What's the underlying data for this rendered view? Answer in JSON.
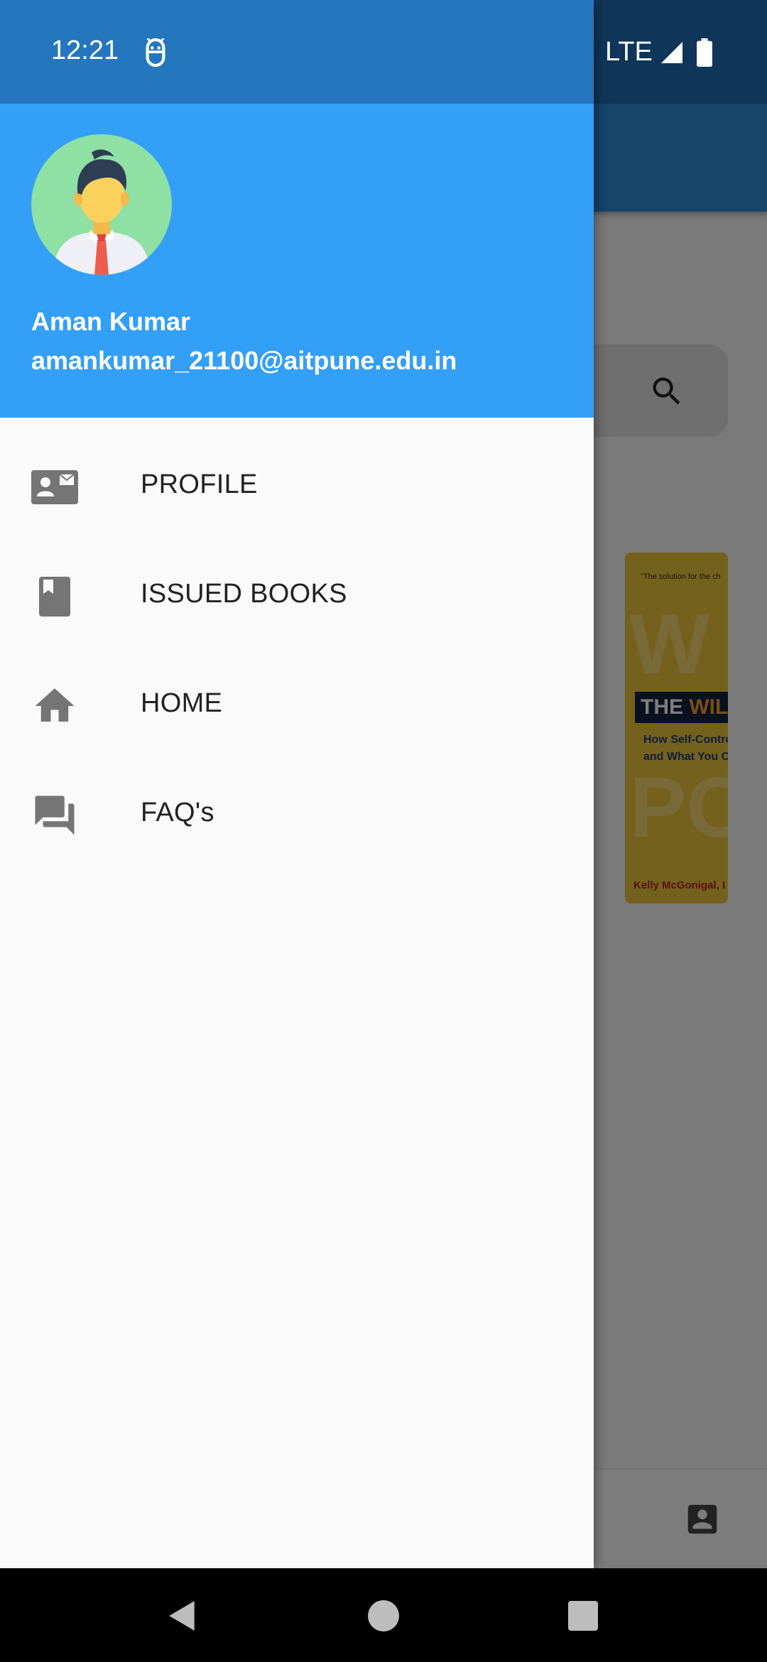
{
  "status_bar": {
    "time": "12:21",
    "network": "LTE"
  },
  "drawer": {
    "user": {
      "name": "Aman Kumar",
      "email": "amankumar_21100@aitpune.edu.in"
    },
    "items": [
      {
        "label": "PROFILE",
        "icon": "contact-card-icon"
      },
      {
        "label": "ISSUED BOOKS",
        "icon": "book-icon"
      },
      {
        "label": "HOME",
        "icon": "home-icon"
      },
      {
        "label": "FAQ's",
        "icon": "forum-icon"
      }
    ]
  },
  "background_app": {
    "book": {
      "quote": "\"The solution for the ch",
      "title_part1": "THE",
      "title_part2": "WILLPO",
      "subtitle_line1": "How Self-Control",
      "subtitle_line2": "and What You Ca",
      "author": "Kelly McGonigal, I"
    }
  },
  "colors": {
    "header_blue": "#339ff7",
    "status_blue": "#2577bd",
    "drawer_bg": "#fafafa",
    "icon_gray": "#757575"
  }
}
